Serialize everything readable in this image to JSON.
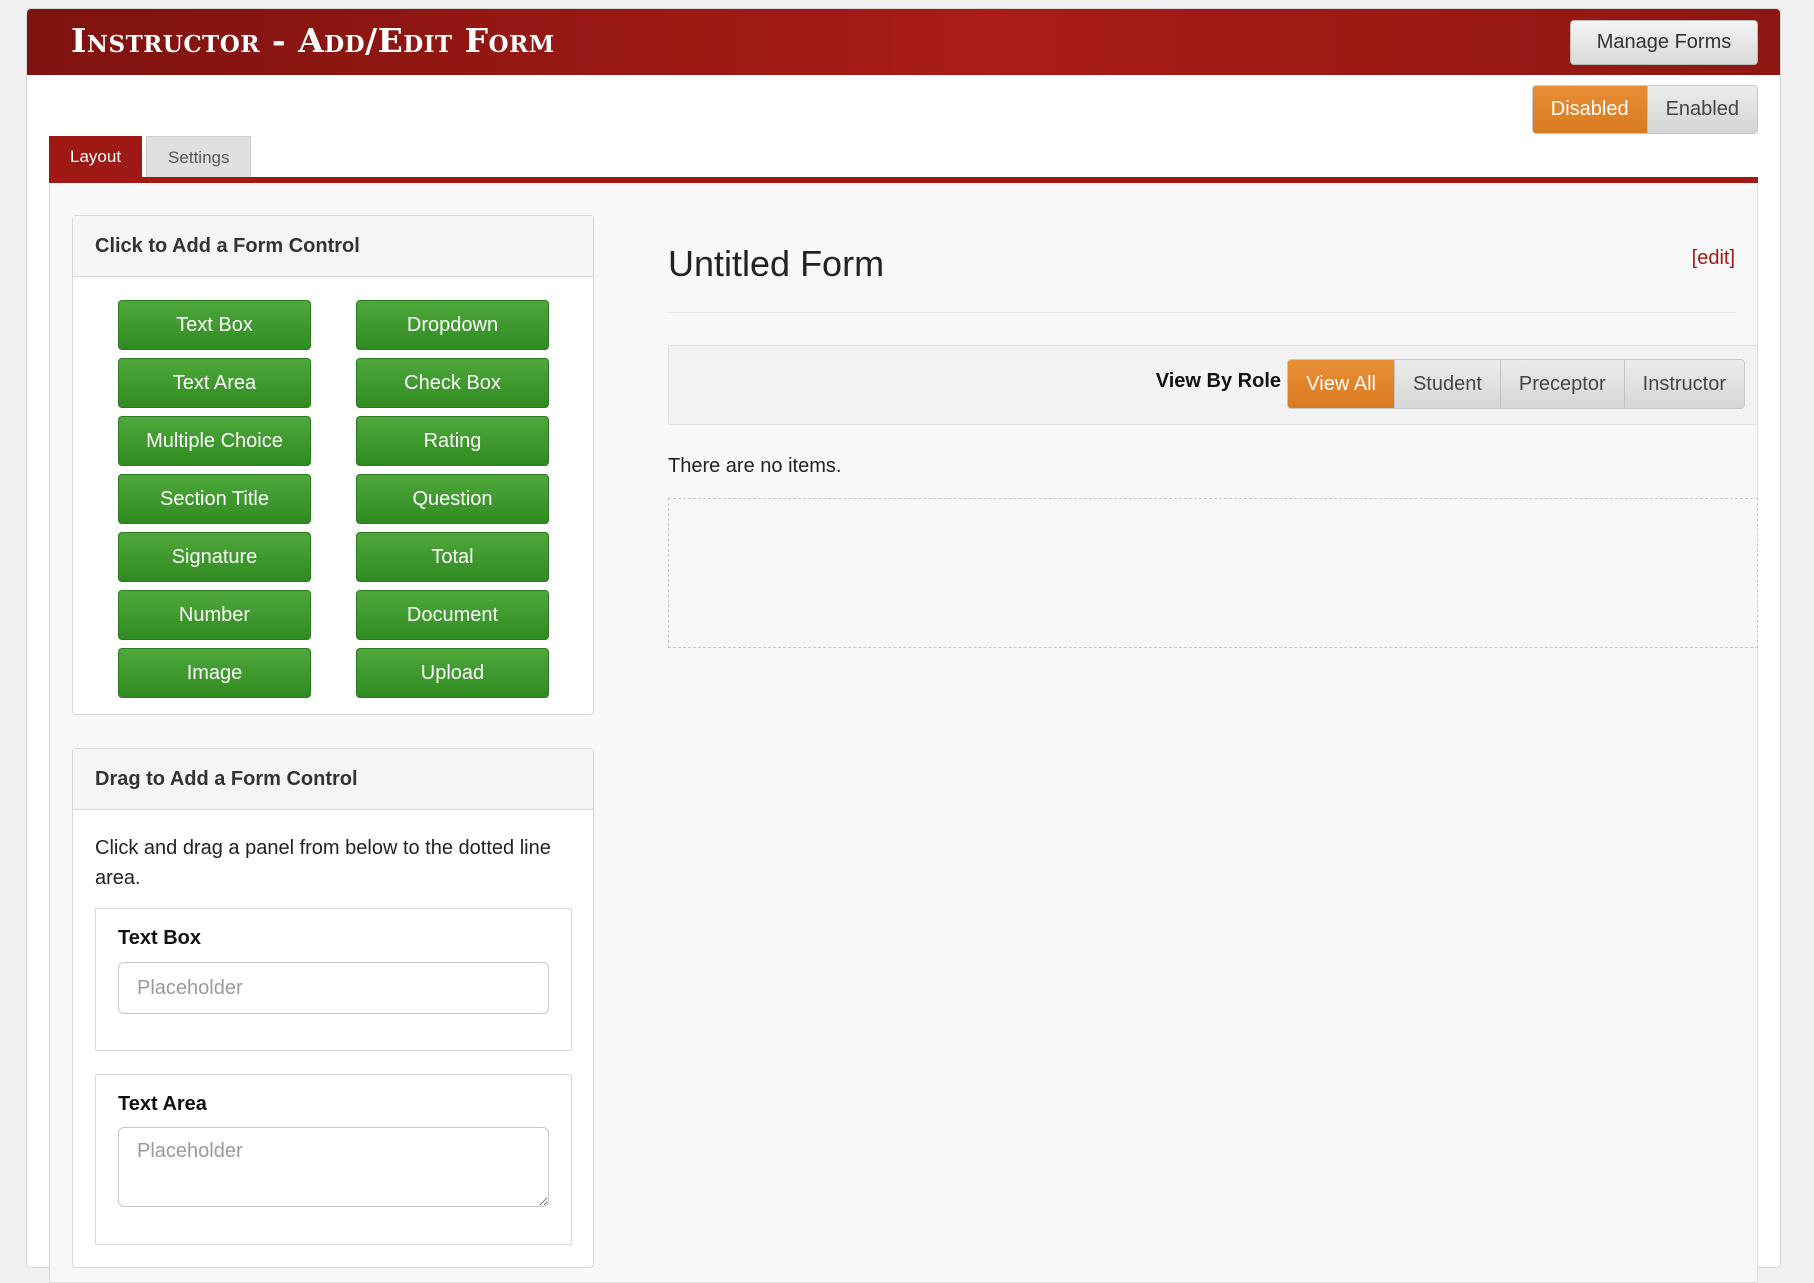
{
  "header": {
    "title": "Instructor - Add/Edit Form",
    "manage_button": "Manage Forms"
  },
  "status_toggle": {
    "options": [
      "Disabled",
      "Enabled"
    ],
    "selected": "Disabled"
  },
  "tabs": [
    {
      "label": "Layout",
      "active": true
    },
    {
      "label": "Settings",
      "active": false
    }
  ],
  "click_panel": {
    "heading": "Click to Add a Form Control",
    "buttons": [
      "Text Box",
      "Dropdown",
      "Text Area",
      "Check Box",
      "Multiple Choice",
      "Rating",
      "Section Title",
      "Question",
      "Signature",
      "Total",
      "Number",
      "Document",
      "Image",
      "Upload"
    ]
  },
  "drag_panel": {
    "heading": "Drag to Add a Form Control",
    "help": "Click and drag a panel from below to the dotted line area.",
    "cards": [
      {
        "label": "Text Box",
        "placeholder": "Placeholder"
      },
      {
        "label": "Text Area",
        "placeholder": "Placeholder"
      }
    ]
  },
  "form": {
    "title": "Untitled Form",
    "edit_link": "[edit]",
    "view_by_role_label": "View By Role",
    "roles": [
      "View All",
      "Student",
      "Preceptor",
      "Instructor"
    ],
    "selected_role": "View All",
    "empty_message": "There are no items."
  },
  "colors": {
    "header_red": "#a31914",
    "accent_orange": "#e08428",
    "control_green": "#3a9a2b"
  }
}
